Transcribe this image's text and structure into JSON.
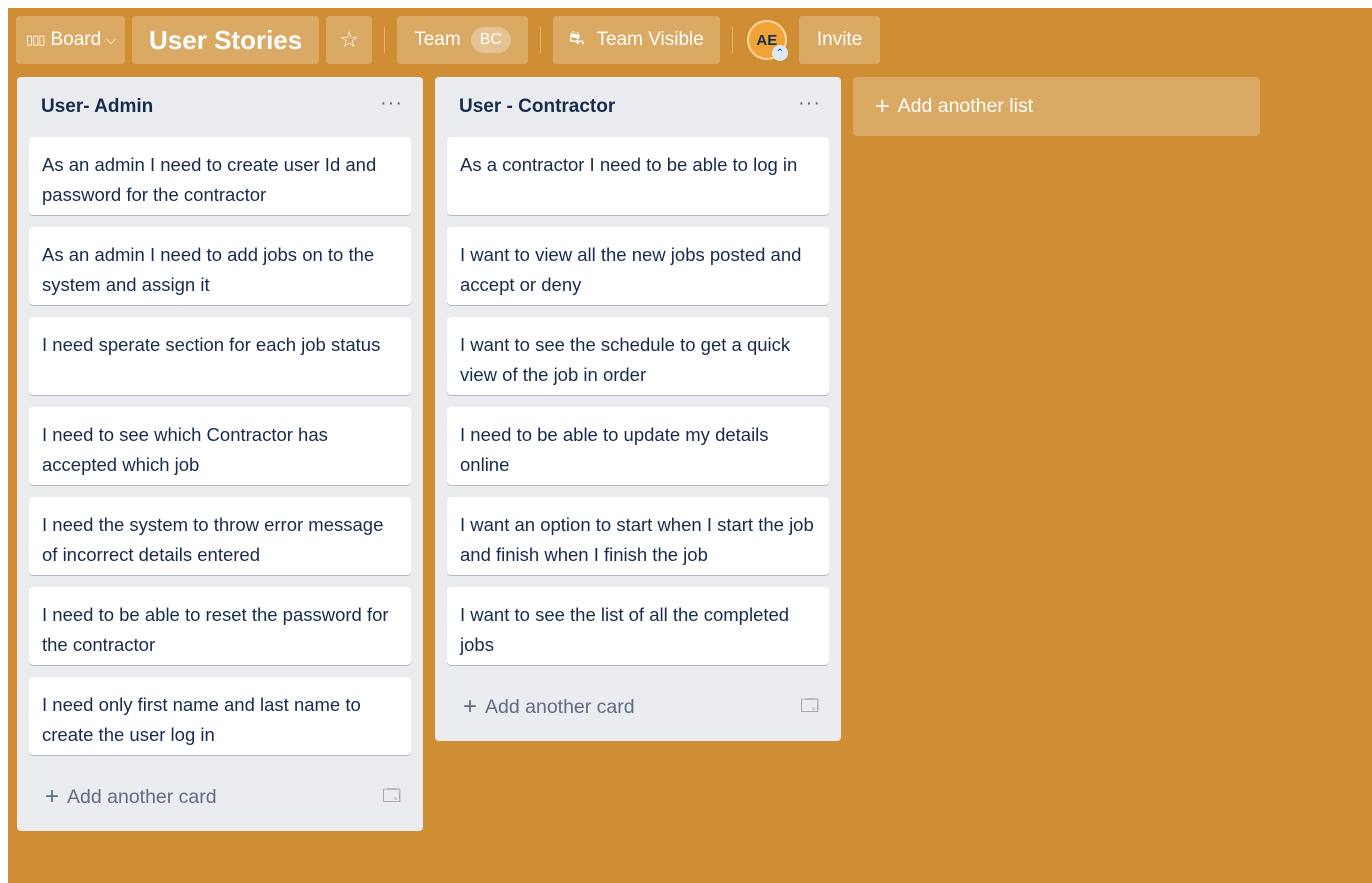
{
  "header": {
    "board_label": "Board",
    "board_icon": "▯▯▯",
    "board_chevron": "⌵",
    "title": "User Stories",
    "star_icon": "☆",
    "team_label": "Team",
    "team_badge": "BC",
    "visibility_icon": "⛐",
    "visibility_label": "Team Visible",
    "avatar_initials": "AE",
    "avatar_badge": "⌃",
    "invite_label": "Invite"
  },
  "lists": [
    {
      "title": "User- Admin",
      "menu": "···",
      "cards": [
        "As an admin I need to create user Id and password for the contractor",
        "As an admin I need to add jobs on to the system and assign it",
        "I need sperate section for each job status",
        "I need to see which Contractor has accepted which job",
        "I need the system to throw error message of incorrect details entered",
        "I need to be able to reset the password for the contractor",
        "I need only first name and last name to create the user log in"
      ],
      "add_card_label": "Add another card",
      "add_card_plus": "+",
      "template_icon": "🗔"
    },
    {
      "title": "User - Contractor",
      "menu": "···",
      "cards": [
        "As a contractor I need to be able to log in",
        "I want to view all the new jobs posted and accept or deny",
        "I want to see the schedule to get a quick view of the job in order",
        "I need to be able to update my details online",
        "I want an option to start when I start the job and finish when I finish the job",
        "I want to see the list of all the completed jobs"
      ],
      "add_card_label": "Add another card",
      "add_card_plus": "+",
      "template_icon": "🗔"
    }
  ],
  "add_list": {
    "plus": "+",
    "label": "Add another list"
  },
  "colors": {
    "board_bg": "#cf8e33",
    "list_bg": "#ebecf0",
    "card_text": "#172b4d"
  }
}
